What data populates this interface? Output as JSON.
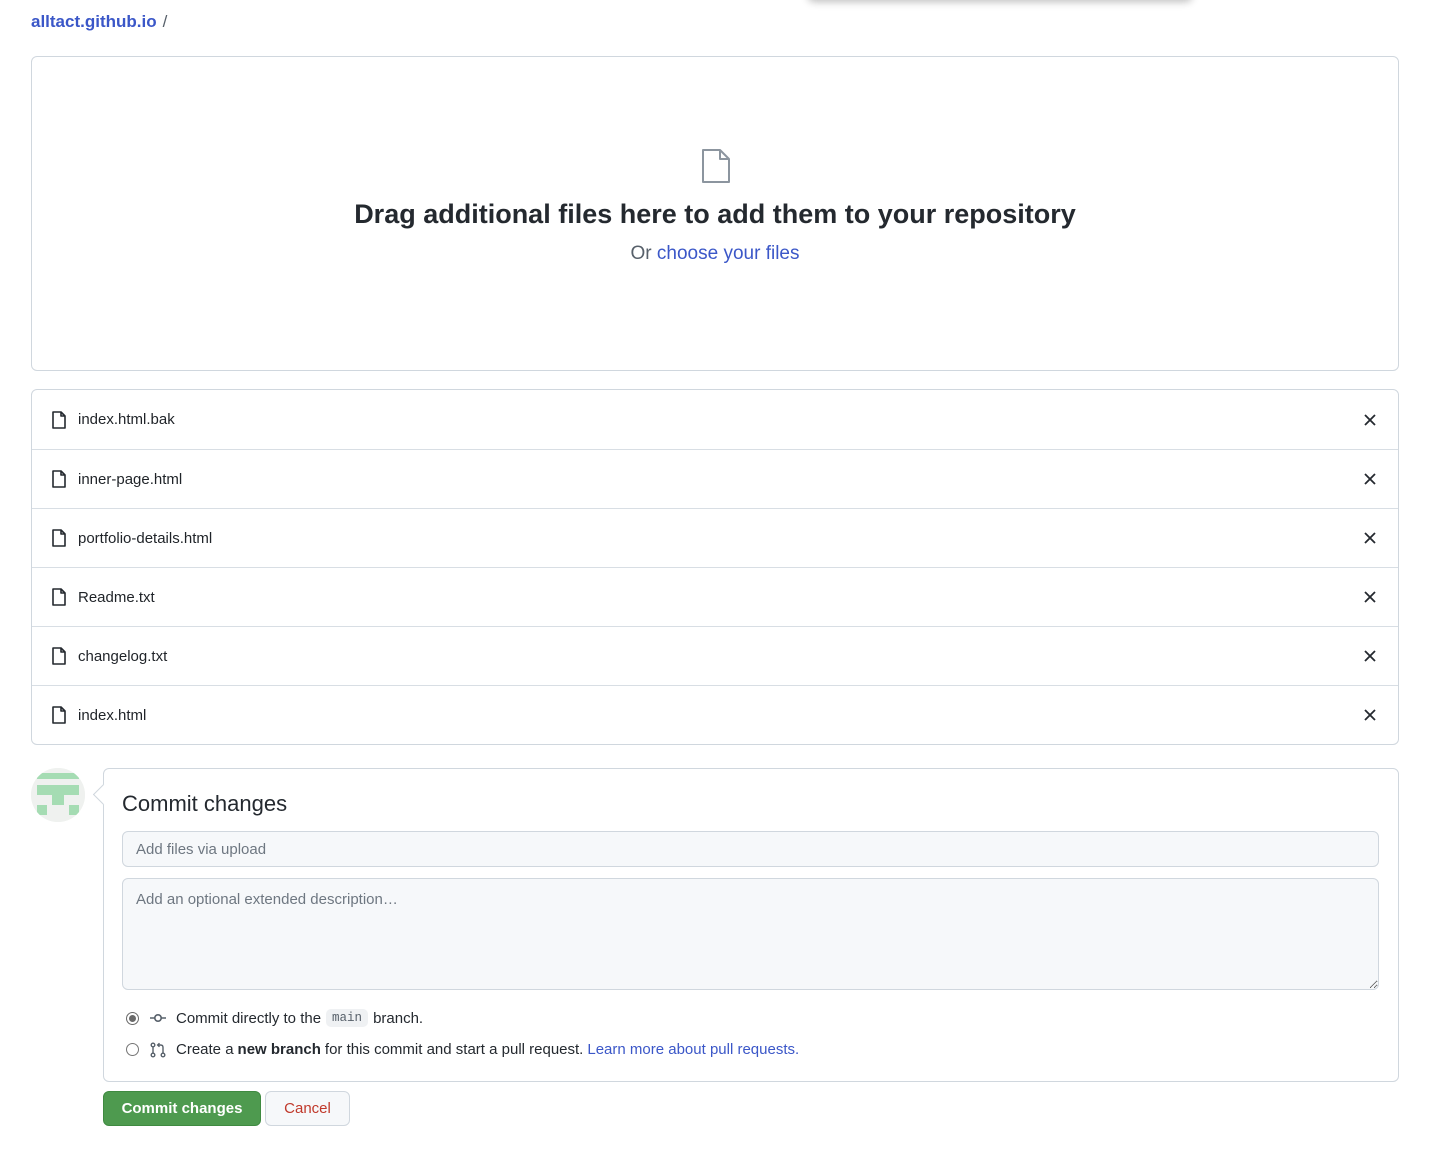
{
  "breadcrumb": {
    "repo": "alltact.github.io",
    "separator": "/"
  },
  "dropzone": {
    "icon": "file-icon",
    "title": "Drag additional files here to add them to your repository",
    "or_text": "Or",
    "choose_link": "choose your files"
  },
  "files": [
    {
      "name": "index.html.bak"
    },
    {
      "name": "inner-page.html"
    },
    {
      "name": "portfolio-details.html"
    },
    {
      "name": "Readme.txt"
    },
    {
      "name": "changelog.txt"
    },
    {
      "name": "index.html"
    }
  ],
  "commit": {
    "heading": "Commit changes",
    "summary_placeholder": "Add files via upload",
    "summary_value": "",
    "description_placeholder": "Add an optional extended description…",
    "option_direct": {
      "prefix": "Commit directly to the",
      "branch": "main",
      "suffix": "branch.",
      "selected": true
    },
    "option_new": {
      "prefix": "Create a",
      "bold": "new branch",
      "suffix": "for this commit and start a pull request.",
      "link": "Learn more about pull requests.",
      "selected": false
    }
  },
  "actions": {
    "commit_label": "Commit changes",
    "cancel_label": "Cancel"
  },
  "colors": {
    "link": "#3b57c8",
    "commit_button": "#4e9a4f",
    "cancel_text": "#c0392b"
  }
}
